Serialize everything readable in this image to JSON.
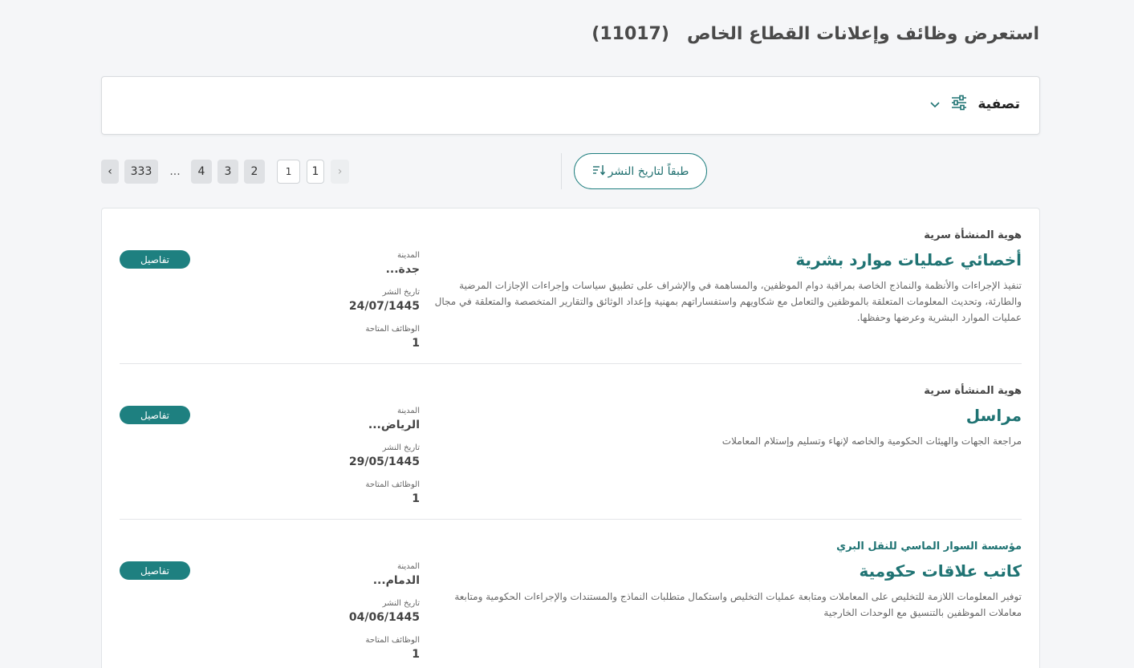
{
  "header": {
    "title": "استعرض وظائف وإعلانات القطاع الخاص",
    "count": "(11017)"
  },
  "filter": {
    "label": "تصفية",
    "icons": [
      "chevron-down-icon",
      "sliders-icon"
    ]
  },
  "sort": {
    "label": "طبقاً لتاريخ النشر",
    "icon": "sort-desc-icon"
  },
  "pagination": {
    "prev": "‹",
    "current_input": "1",
    "pages": [
      "1",
      "2",
      "3",
      "4",
      "...",
      "333"
    ],
    "next": "›"
  },
  "jobs": [
    {
      "org": "هوية المنشأة سرية",
      "title": "أخصائي عمليات موارد بشرية",
      "description": "تنفيذ الإجراءات والأنظمة والنماذج الخاصة بمراقبة دوام الموظفين، والمساهمة في والإشراف على تطبيق سياسات وإجراءات الإجازات المرضية والطارئة، وتحديث المعلومات المتعلقة بالموظفين والتعامل مع شكاويهم واستفساراتهم بمهنية وإعداد الوثائق والتقارير المتخصصة والمتعلقة في مجال عمليات الموارد البشرية وعرضها وحفظها.",
      "city_label": "المدينة",
      "city": "جدة...",
      "date_label": "تاريخ النشر",
      "date": "24/07/1445",
      "vacancies_label": "الوظائف المتاحة",
      "vacancies": "1",
      "details": "تفاصيل"
    },
    {
      "org": "هوية المنشأة سرية",
      "title": "مراسل",
      "description": "مراجعة الجهات والهيئات الحكومية والخاصه لإنهاء وتسليم وإستلام المعاملات",
      "city_label": "المدينة",
      "city": "الرياض...",
      "date_label": "تاريخ النشر",
      "date": "29/05/1445",
      "vacancies_label": "الوظائف المتاحة",
      "vacancies": "1",
      "details": "تفاصيل"
    },
    {
      "org": "مؤسسة السوار الماسي للنقل البري",
      "title": "كاتب علاقات حكومية",
      "description": "توفير المعلومات اللازمة للتخليص على المعاملات ومتابعة عمليات التخليص واستكمال متطلبات النماذج والمستندات والإجراءات الحكومية ومتابعة معاملات الموظفين بالتنسيق مع الوحدات الخارجية",
      "city_label": "المدينة",
      "city": "الدمام...",
      "date_label": "تاريخ النشر",
      "date": "04/06/1445",
      "vacancies_label": "الوظائف المتاحة",
      "vacancies": "1",
      "details": "تفاصيل"
    }
  ],
  "colors": {
    "accent": "#1e8080",
    "title_teal": "#1f7373",
    "background": "#f5f6f8"
  }
}
